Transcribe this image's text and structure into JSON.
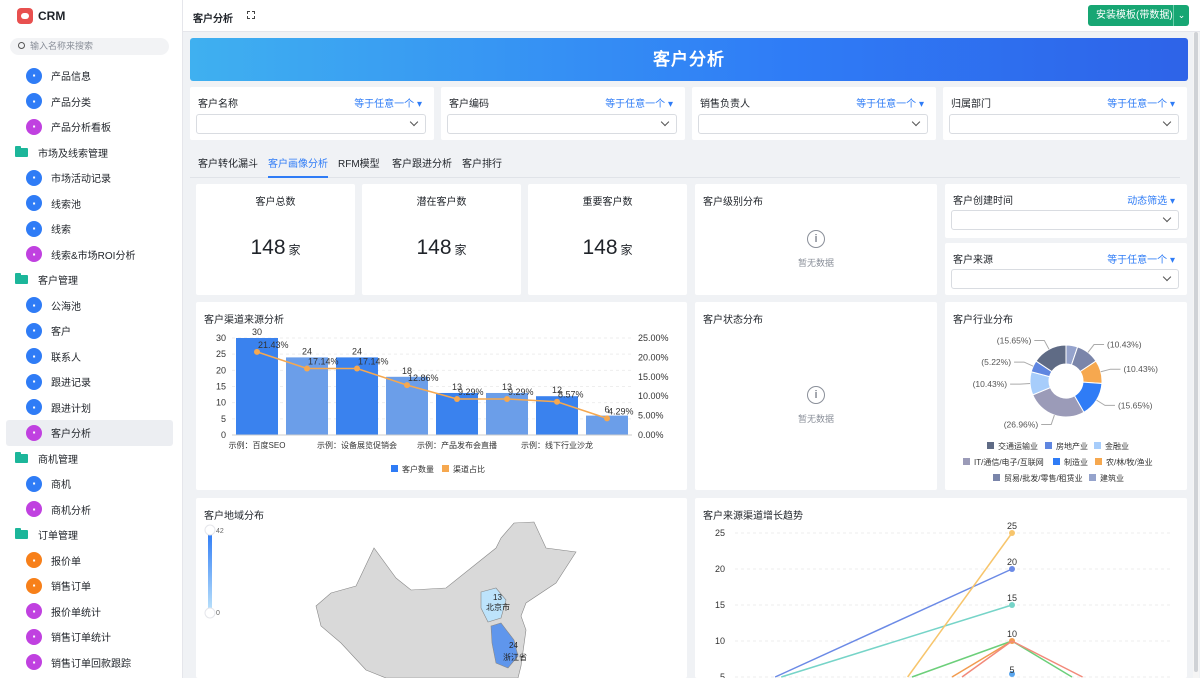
{
  "app": {
    "brand": "CRM",
    "search_placeholder": "输入名称来搜索",
    "page_title": "客户分析",
    "install_button": "安装模板(带数据)"
  },
  "sidebar": {
    "items": [
      {
        "type": "child",
        "label": "产品信息",
        "icon": "document-icon",
        "color": "#2f7cf6"
      },
      {
        "type": "child",
        "label": "产品分类",
        "icon": "bookmark-icon",
        "color": "#2f7cf6"
      },
      {
        "type": "child",
        "label": "产品分析看板",
        "icon": "dashboard-icon",
        "color": "#c041e0"
      },
      {
        "type": "group",
        "label": "市场及线索管理",
        "icon": "folder-icon"
      },
      {
        "type": "child",
        "label": "市场活动记录",
        "icon": "document-icon",
        "color": "#2f7cf6"
      },
      {
        "type": "child",
        "label": "线索池",
        "icon": "pool-icon",
        "color": "#2f7cf6"
      },
      {
        "type": "child",
        "label": "线索",
        "icon": "lead-icon",
        "color": "#2f7cf6"
      },
      {
        "type": "child",
        "label": "线索&市场ROI分析",
        "icon": "dashboard-icon",
        "color": "#c041e0"
      },
      {
        "type": "group",
        "label": "客户管理",
        "icon": "folder-icon"
      },
      {
        "type": "child",
        "label": "公海池",
        "icon": "users-icon",
        "color": "#2f7cf6"
      },
      {
        "type": "child",
        "label": "客户",
        "icon": "user-icon",
        "color": "#2f7cf6"
      },
      {
        "type": "child",
        "label": "联系人",
        "icon": "contact-icon",
        "color": "#2f7cf6"
      },
      {
        "type": "child",
        "label": "跟进记录",
        "icon": "document-icon",
        "color": "#2f7cf6"
      },
      {
        "type": "child",
        "label": "跟进计划",
        "icon": "document-icon",
        "color": "#2f7cf6"
      },
      {
        "type": "child",
        "label": "客户分析",
        "icon": "dashboard-icon",
        "color": "#c041e0",
        "active": true
      },
      {
        "type": "group",
        "label": "商机管理",
        "icon": "folder-icon"
      },
      {
        "type": "child",
        "label": "商机",
        "icon": "opportunity-icon",
        "color": "#2f7cf6"
      },
      {
        "type": "child",
        "label": "商机分析",
        "icon": "dashboard-icon",
        "color": "#c041e0"
      },
      {
        "type": "group",
        "label": "订单管理",
        "icon": "folder-icon"
      },
      {
        "type": "child",
        "label": "报价单",
        "icon": "send-icon",
        "color": "#f7801a"
      },
      {
        "type": "child",
        "label": "销售订单",
        "icon": "order-icon",
        "color": "#f7801a"
      },
      {
        "type": "child",
        "label": "报价单统计",
        "icon": "dashboard-icon",
        "color": "#c041e0"
      },
      {
        "type": "child",
        "label": "销售订单统计",
        "icon": "dashboard-icon",
        "color": "#c041e0"
      },
      {
        "type": "child",
        "label": "销售订单回款跟踪",
        "icon": "dashboard-icon",
        "color": "#c041e0"
      }
    ]
  },
  "banner": {
    "title": "客户分析"
  },
  "filters": [
    {
      "label": "客户名称",
      "op": "等于任意一个"
    },
    {
      "label": "客户编码",
      "op": "等于任意一个"
    },
    {
      "label": "销售负责人",
      "op": "等于任意一个"
    },
    {
      "label": "归属部门",
      "op": "等于任意一个"
    }
  ],
  "tabs": [
    {
      "label": "客户转化漏斗"
    },
    {
      "label": "客户画像分析",
      "active": true
    },
    {
      "label": "RFM模型"
    },
    {
      "label": "客户跟进分析"
    },
    {
      "label": "客户排行"
    }
  ],
  "stats": [
    {
      "title": "客户总数",
      "value": "148",
      "unit": "家"
    },
    {
      "title": "潜在客户数",
      "value": "148",
      "unit": "家"
    },
    {
      "title": "重要客户数",
      "value": "148",
      "unit": "家"
    }
  ],
  "level_card": {
    "title": "客户级别分布",
    "empty": "暂无数据"
  },
  "side_filters": [
    {
      "label": "客户创建时间",
      "op": "动态筛选"
    },
    {
      "label": "客户来源",
      "op": "等于任意一个"
    }
  ],
  "status_card": {
    "title": "客户状态分布",
    "empty": "暂无数据"
  },
  "map_card": {
    "title": "客户地域分布",
    "scale_max": "42",
    "scale_min": "0",
    "regions": [
      {
        "name": "北京市",
        "value": "13"
      },
      {
        "name": "浙江省",
        "value": "24"
      }
    ]
  },
  "chart_data": [
    {
      "type": "bar",
      "title": "客户渠道来源分析",
      "categories": [
        "示例：百度SEO",
        "",
        "示例：设备展览促销会",
        "",
        "示例：产品发布会直播",
        "",
        "示例：线下行业沙龙",
        ""
      ],
      "series": [
        {
          "name": "客户数量",
          "values": [
            30,
            24,
            24,
            18,
            13,
            13,
            12,
            6
          ],
          "color": "#2f7cf6"
        },
        {
          "name": "渠道占比",
          "values": [
            21.43,
            17.14,
            17.14,
            12.86,
            9.29,
            9.29,
            8.57,
            4.29
          ],
          "labels": [
            "21.43%",
            "17.14%",
            "17.14%",
            "12.86%",
            "9.29%",
            "9.29%",
            "8.57%",
            "4.29%"
          ],
          "color": "#f6a84f",
          "axis": "right"
        }
      ],
      "ylim": [
        0,
        30
      ],
      "yticks": [
        "0",
        "5",
        "10",
        "15",
        "20",
        "25",
        "30"
      ],
      "y2lim": [
        0,
        25
      ],
      "y2ticks": [
        "0.00%",
        "5.00%",
        "10.00%",
        "15.00%",
        "20.00%",
        "25.00%"
      ],
      "legend": "bottom"
    },
    {
      "type": "pie",
      "title": "客户行业分布",
      "slices": [
        {
          "name": "建筑业",
          "value": 5.22,
          "label": "",
          "color": "#95a3cc"
        },
        {
          "name": "贸易/批发/零售/租赁业",
          "value": 10.43,
          "label": "(10.43%)",
          "color": "#7a85aa"
        },
        {
          "name": "农/林/牧/渔业",
          "value": 10.43,
          "label": "(10.43%)",
          "color": "#f6a84f"
        },
        {
          "name": "制造业",
          "value": 15.65,
          "label": "(15.65%)",
          "color": "#2f7cf6"
        },
        {
          "name": "IT/通信/电子/互联网",
          "value": 26.96,
          "label": "(26.96%)",
          "color": "#9b9bb8"
        },
        {
          "name": "金融业",
          "value": 10.43,
          "label": "(10.43%)",
          "color": "#a7cdfb"
        },
        {
          "name": "房地产业",
          "value": 5.22,
          "label": "(5.22%)",
          "color": "#5f86e0"
        },
        {
          "name": "交通运输业",
          "value": 15.65,
          "label": "(15.65%)",
          "color": "#5f6b85"
        }
      ],
      "legend_order": [
        "交通运输业",
        "房地产业",
        "金融业",
        "IT/通信/电子/互联网",
        "制造业",
        "农/林/牧/渔业",
        "贸易/批发/零售/租赁业",
        "建筑业"
      ],
      "legend": "bottom"
    },
    {
      "type": "line",
      "title": "客户来源渠道增长趋势",
      "ylim": [
        0,
        25
      ],
      "yticks": [
        "5",
        "10",
        "15",
        "20",
        "25"
      ],
      "series": [
        {
          "values": [
            4.8,
            12.4,
            20
          ],
          "color": "#6b8ae6",
          "labels": [
            null,
            null,
            "20"
          ]
        },
        {
          "values": [
            4.6,
            9.8,
            15
          ],
          "color": "#76d4c8",
          "labels": [
            null,
            null,
            "15"
          ]
        },
        {
          "values": [
            null,
            2,
            25
          ],
          "color": "#f7c56c",
          "labels": [
            null,
            null,
            "25"
          ]
        },
        {
          "values": [
            null,
            4,
            10,
            0
          ],
          "color": "#6ccf7a"
        },
        {
          "values": [
            null,
            0,
            10
          ],
          "color": "#f29b4f",
          "labels": [
            null,
            null,
            "10"
          ]
        },
        {
          "values": [
            null,
            -2,
            10,
            1.5
          ],
          "color": "#f28a7a"
        },
        {
          "values": [
            null,
            null,
            5
          ],
          "color": "#5aa7f0",
          "labels": [
            null,
            null,
            "5"
          ]
        }
      ]
    }
  ]
}
